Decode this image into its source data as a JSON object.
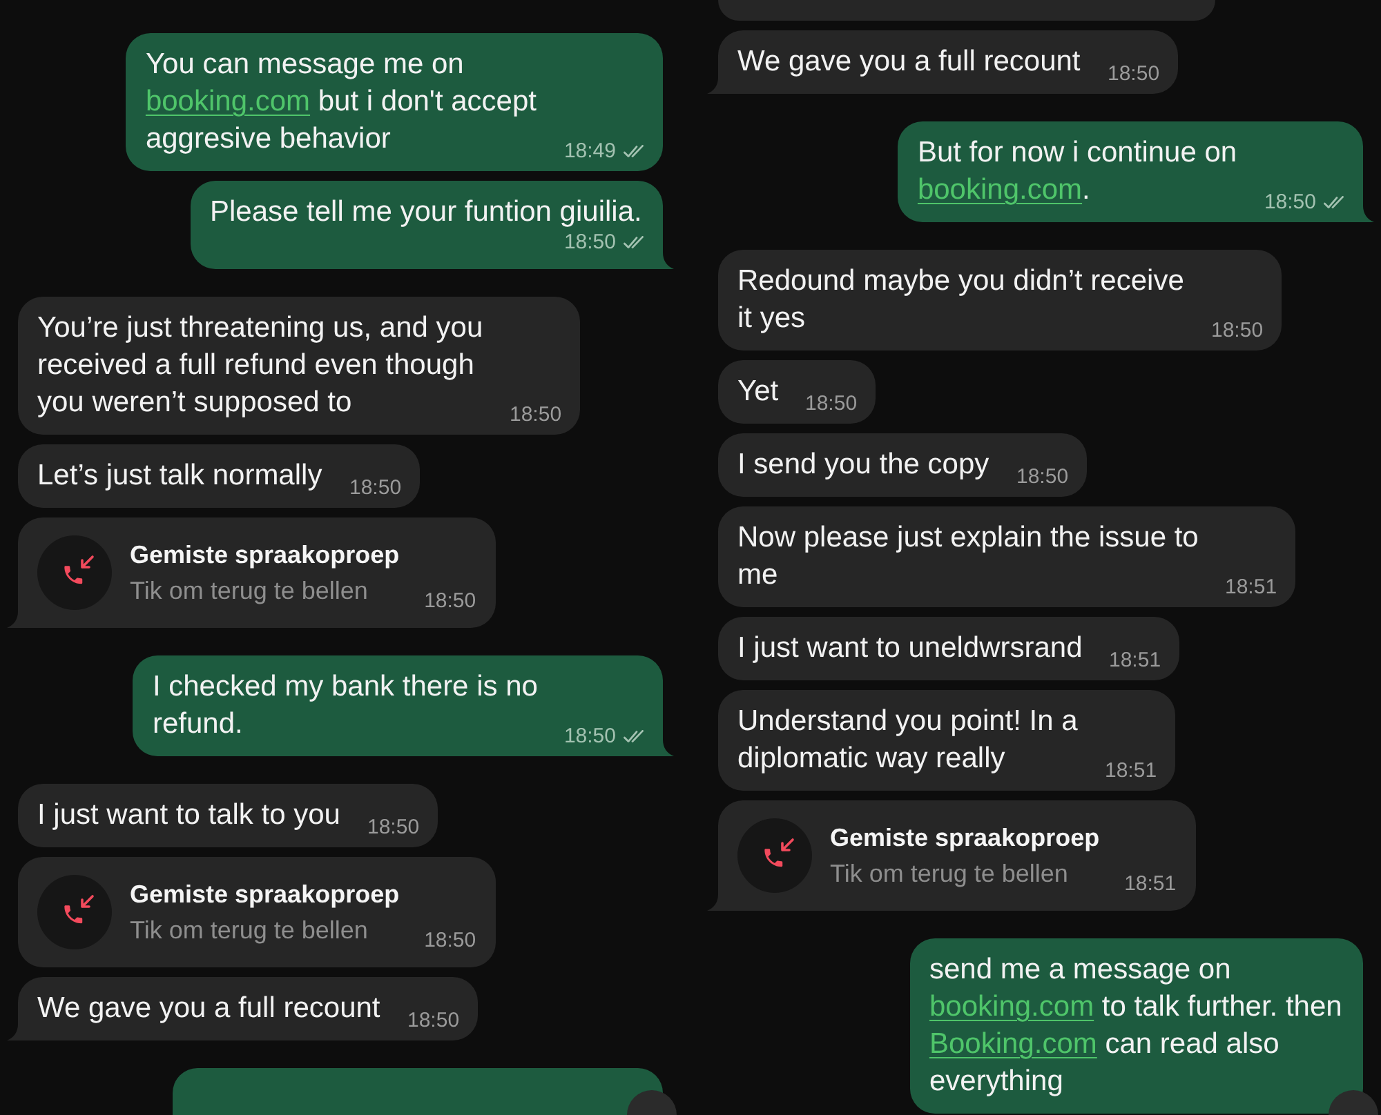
{
  "panes": [
    {
      "scroll_button": true,
      "messages": [
        {
          "kind": "text",
          "outgoing": true,
          "tail": false,
          "parts": [
            {
              "kind": "text",
              "text": "You can message me on "
            },
            {
              "kind": "link",
              "text": "booking.com"
            },
            {
              "kind": "text",
              "text": " but i don't accept aggresive behavior"
            }
          ],
          "time": "18:49",
          "read": false
        },
        {
          "kind": "text",
          "outgoing": true,
          "tail": true,
          "parts": [
            {
              "kind": "text",
              "text": "Please tell me your funtion giuilia."
            }
          ],
          "time": "18:50",
          "read": false
        },
        {
          "kind": "text",
          "outgoing": false,
          "tail": false,
          "parts": [
            {
              "kind": "text",
              "text": "You’re just threatening us, and you received a full refund even though you weren’t supposed to"
            }
          ],
          "time": "18:50"
        },
        {
          "kind": "text",
          "outgoing": false,
          "tail": false,
          "parts": [
            {
              "kind": "text",
              "text": "Let’s just talk normally"
            }
          ],
          "time": "18:50"
        },
        {
          "kind": "missed_call",
          "outgoing": false,
          "tail": true,
          "title": "Gemiste spraakoproep",
          "subtitle": "Tik om terug te bellen",
          "time": "18:50"
        },
        {
          "kind": "text",
          "outgoing": true,
          "tail": true,
          "parts": [
            {
              "kind": "text",
              "text": "I checked my bank there is no refund."
            }
          ],
          "time": "18:50",
          "read": false
        },
        {
          "kind": "text",
          "outgoing": false,
          "tail": false,
          "parts": [
            {
              "kind": "text",
              "text": "I just want to talk to you"
            }
          ],
          "time": "18:50"
        },
        {
          "kind": "missed_call",
          "outgoing": false,
          "tail": false,
          "title": "Gemiste spraakoproep",
          "subtitle": "Tik om terug te bellen",
          "time": "18:50"
        },
        {
          "kind": "text",
          "outgoing": false,
          "tail": true,
          "parts": [
            {
              "kind": "text",
              "text": "We gave you a full recount"
            }
          ],
          "time": "18:50"
        },
        {
          "kind": "cut_off",
          "outgoing": true
        }
      ]
    },
    {
      "scroll_button": true,
      "messages": [
        {
          "kind": "cut_off",
          "outgoing": false
        },
        {
          "kind": "text",
          "outgoing": false,
          "tail": true,
          "parts": [
            {
              "kind": "text",
              "text": "We gave you a full recount"
            }
          ],
          "time": "18:50"
        },
        {
          "kind": "text",
          "outgoing": true,
          "tail": true,
          "parts": [
            {
              "kind": "text",
              "text": "But for now i continue on "
            },
            {
              "kind": "link",
              "text": "booking.com"
            },
            {
              "kind": "text",
              "text": "."
            }
          ],
          "time": "18:50",
          "read": false
        },
        {
          "kind": "text",
          "outgoing": false,
          "tail": false,
          "parts": [
            {
              "kind": "text",
              "text": "Redound maybe you didn’t receive it yes"
            }
          ],
          "time": "18:50"
        },
        {
          "kind": "text",
          "outgoing": false,
          "tail": false,
          "parts": [
            {
              "kind": "text",
              "text": "Yet"
            }
          ],
          "time": "18:50"
        },
        {
          "kind": "text",
          "outgoing": false,
          "tail": false,
          "parts": [
            {
              "kind": "text",
              "text": "I send you the copy"
            }
          ],
          "time": "18:50"
        },
        {
          "kind": "text",
          "outgoing": false,
          "tail": false,
          "parts": [
            {
              "kind": "text",
              "text": "Now please just explain the issue to me"
            }
          ],
          "time": "18:51"
        },
        {
          "kind": "text",
          "outgoing": false,
          "tail": false,
          "parts": [
            {
              "kind": "text",
              "text": "I just want to uneldwrsrand"
            }
          ],
          "time": "18:51"
        },
        {
          "kind": "text",
          "outgoing": false,
          "tail": false,
          "parts": [
            {
              "kind": "text",
              "text": "Understand you point! In a diplomatic way really"
            }
          ],
          "time": "18:51"
        },
        {
          "kind": "missed_call",
          "outgoing": false,
          "tail": true,
          "title": "Gemiste spraakoproep",
          "subtitle": "Tik om terug te bellen",
          "time": "18:51"
        },
        {
          "kind": "text",
          "outgoing": true,
          "tail": false,
          "parts": [
            {
              "kind": "text",
              "text": "send me a message on "
            },
            {
              "kind": "link",
              "text": "booking.com"
            },
            {
              "kind": "text",
              "text": " to talk further. then "
            },
            {
              "kind": "link",
              "text": "Booking.com"
            },
            {
              "kind": "text",
              "text": " can read also everything"
            }
          ]
        }
      ]
    }
  ]
}
